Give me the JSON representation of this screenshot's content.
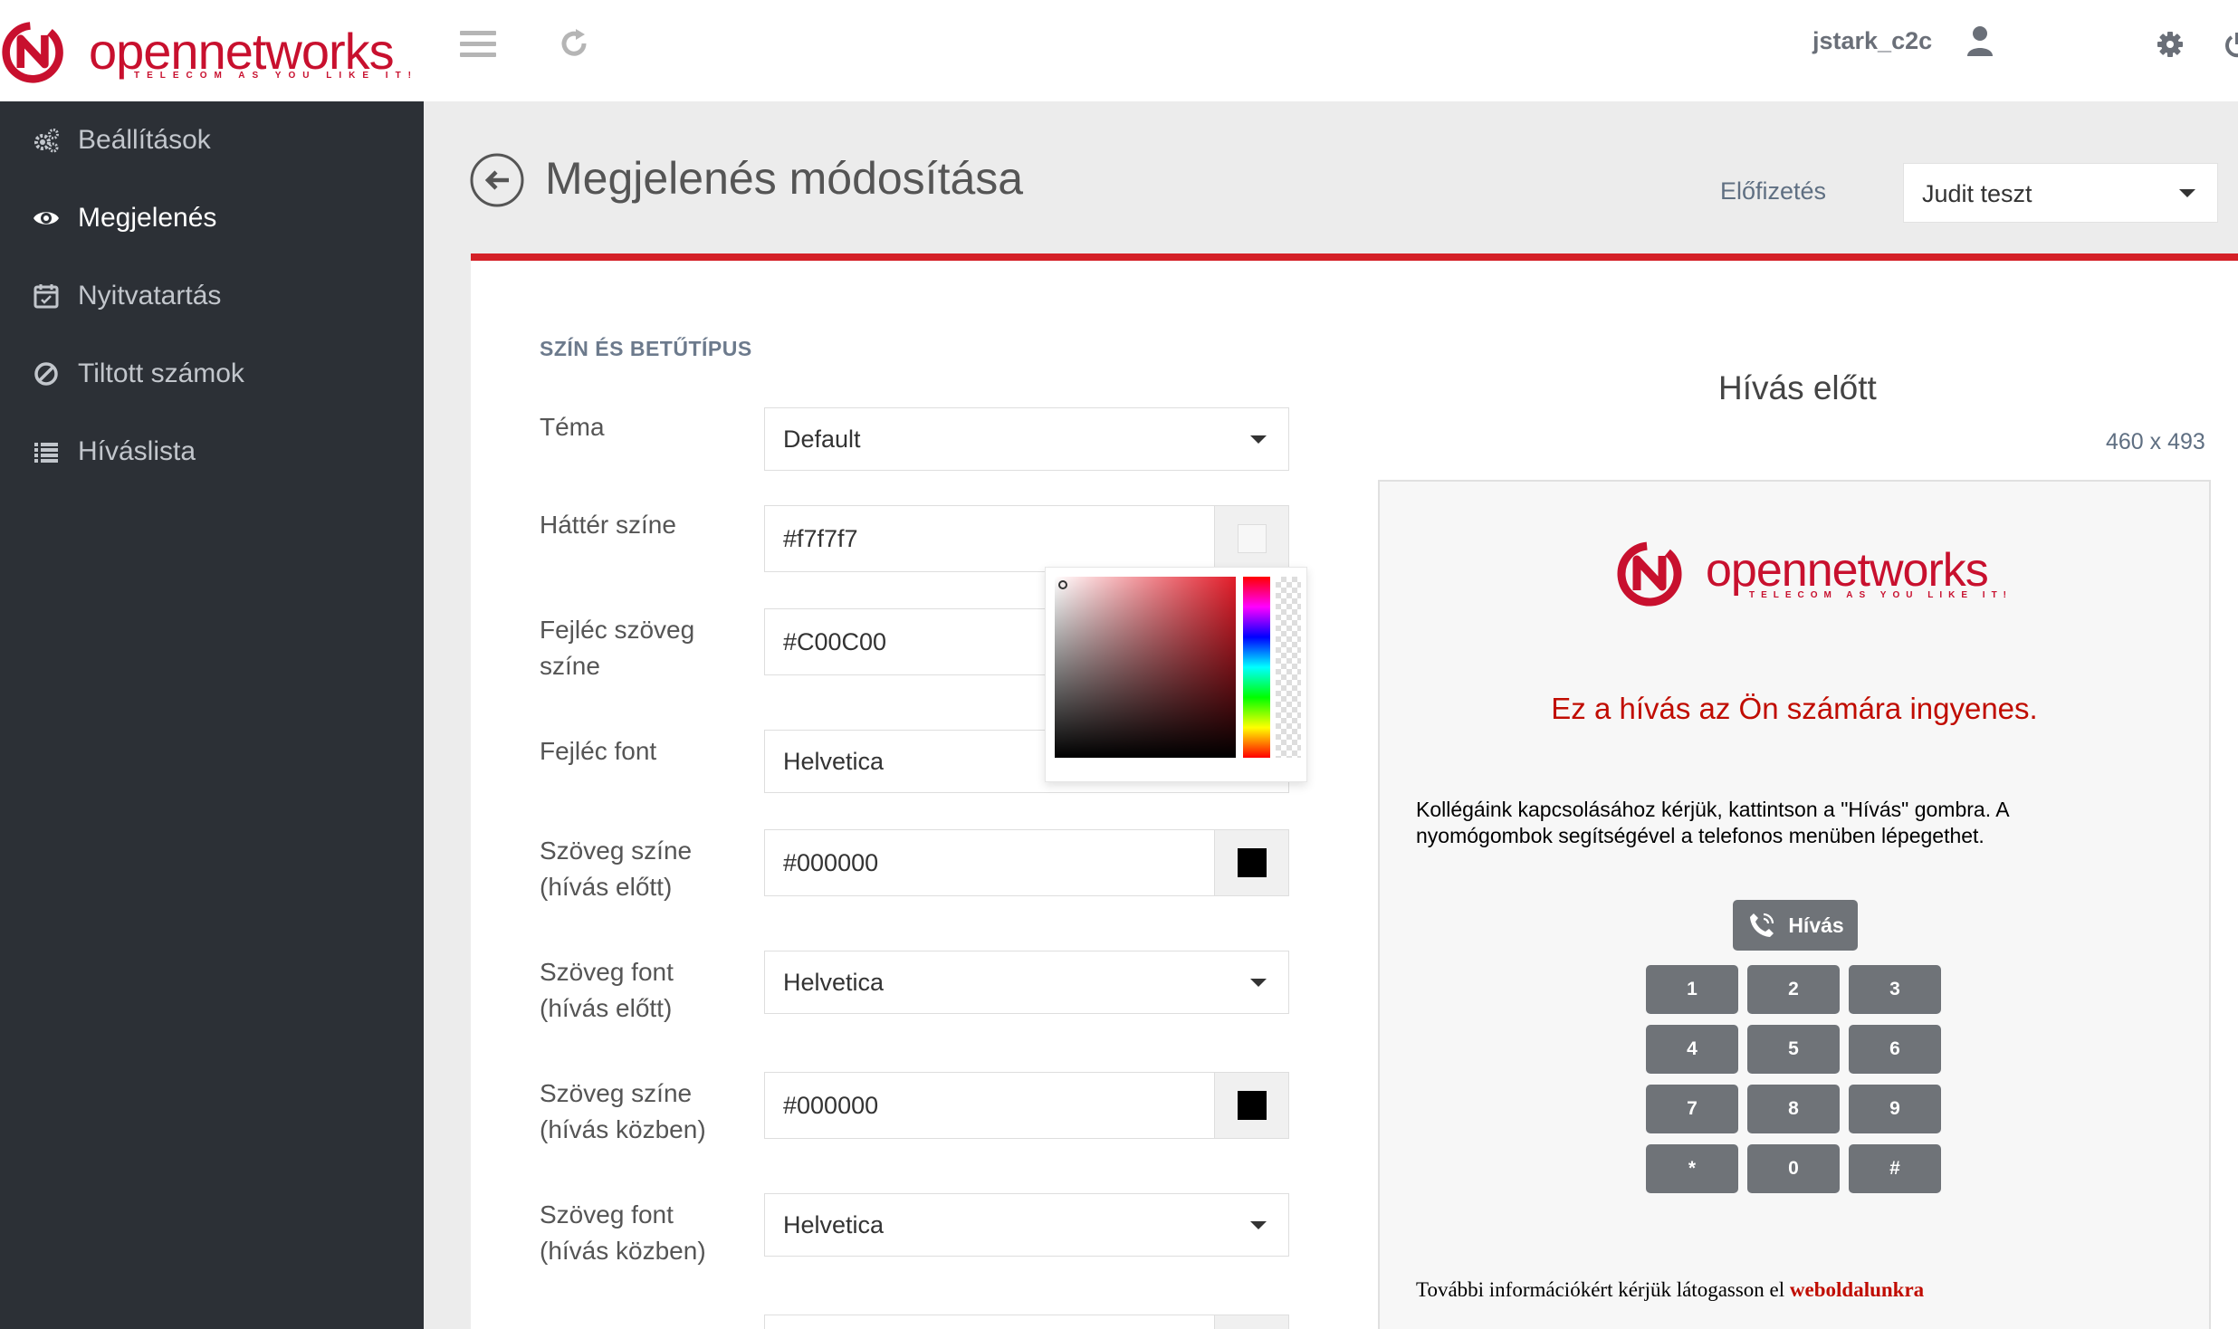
{
  "header": {
    "brand": "opennetworks",
    "brand_bold_part": "open",
    "brand_thin_part": "networks",
    "tagline": "TELECOM AS YOU LIKE IT!",
    "username": "jstark_c2c"
  },
  "sidebar": {
    "items": [
      {
        "label": "Beállítások",
        "icon": "gears-icon",
        "active": false
      },
      {
        "label": "Megjelenés",
        "icon": "eye-icon",
        "active": true
      },
      {
        "label": "Nyitvatartás",
        "icon": "calendar-icon",
        "active": false
      },
      {
        "label": "Tiltott számok",
        "icon": "ban-icon",
        "active": false
      },
      {
        "label": "Híváslista",
        "icon": "list-icon",
        "active": false
      }
    ]
  },
  "page": {
    "title": "Megjelenés módosítása",
    "subscription_label": "Előfizetés",
    "subscription_value": "Judit teszt"
  },
  "form": {
    "section_title": "SZÍN ÉS BETŰTÍPUS",
    "rows": [
      {
        "label": "Téma",
        "value": "Default",
        "type": "select"
      },
      {
        "label": "Háttér színe",
        "value": "#f7f7f7",
        "type": "color",
        "swatch": "#f7f7f7"
      },
      {
        "label": "Fejléc szöveg színe",
        "value": "#C00C00",
        "type": "color",
        "swatch": "#C00C00"
      },
      {
        "label": "Fejléc font",
        "value": "Helvetica",
        "type": "select"
      },
      {
        "label": "Szöveg színe (hívás előtt)",
        "value": "#000000",
        "type": "color",
        "swatch": "#000000"
      },
      {
        "label": "Szöveg font (hívás előtt)",
        "value": "Helvetica",
        "type": "select"
      },
      {
        "label": "Szöveg színe (hívás közben)",
        "value": "#000000",
        "type": "color",
        "swatch": "#000000"
      },
      {
        "label": "Szöveg font (hívás közben)",
        "value": "Helvetica",
        "type": "select"
      }
    ]
  },
  "preview": {
    "title": "Hívás előtt",
    "size": "460 x 493",
    "headline": "Ez a hívás az Ön számára ingyenes.",
    "text": "Kollégáink kapcsolásához kérjük, kattintson a \"Hívás\" gombra. A nyomógombok segítségével a telefonos menüben lépegethet.",
    "call_button": "Hívás",
    "keys": [
      "1",
      "2",
      "3",
      "4",
      "5",
      "6",
      "7",
      "8",
      "9",
      "*",
      "0",
      "#"
    ],
    "footer_text": "További információkért kérjük látogasson el ",
    "footer_link": "weboldalunkra"
  },
  "colors": {
    "brand_red": "#c8102e",
    "accent_red": "#d42027",
    "sidebar_bg": "#2c3036",
    "key_bg": "#6f7378"
  }
}
